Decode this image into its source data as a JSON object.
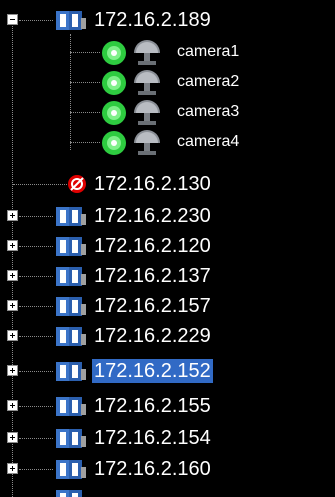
{
  "tree": {
    "root": {
      "label": "172.16.2.189",
      "expanded": true
    },
    "cameras": [
      {
        "label": "camera1",
        "status": "online"
      },
      {
        "label": "camera2",
        "status": "online"
      },
      {
        "label": "camera3",
        "status": "online"
      },
      {
        "label": "camera4",
        "status": "online"
      }
    ],
    "offline_host": {
      "label": "172.16.2.130",
      "status": "offline"
    },
    "hosts": [
      {
        "label": "172.16.2.230"
      },
      {
        "label": "172.16.2.120"
      },
      {
        "label": "172.16.2.137"
      },
      {
        "label": "172.16.2.157"
      },
      {
        "label": "172.16.2.229"
      },
      {
        "label": "172.16.2.152",
        "selected": true
      },
      {
        "label": "172.16.2.155"
      },
      {
        "label": "172.16.2.154"
      },
      {
        "label": "172.16.2.160"
      }
    ],
    "icons": {
      "host": "book-icon",
      "camera_status": "green-status-icon",
      "camera": "dome-camera-icon",
      "offline": "disconnected-icon",
      "expander_open": "collapse-icon",
      "expander_closed": "expand-icon"
    },
    "colors": {
      "background": "#000000",
      "text": "#ffffff",
      "selection": "#316ac5",
      "status_online": "#2ecc40",
      "status_offline": "#e00000"
    }
  }
}
